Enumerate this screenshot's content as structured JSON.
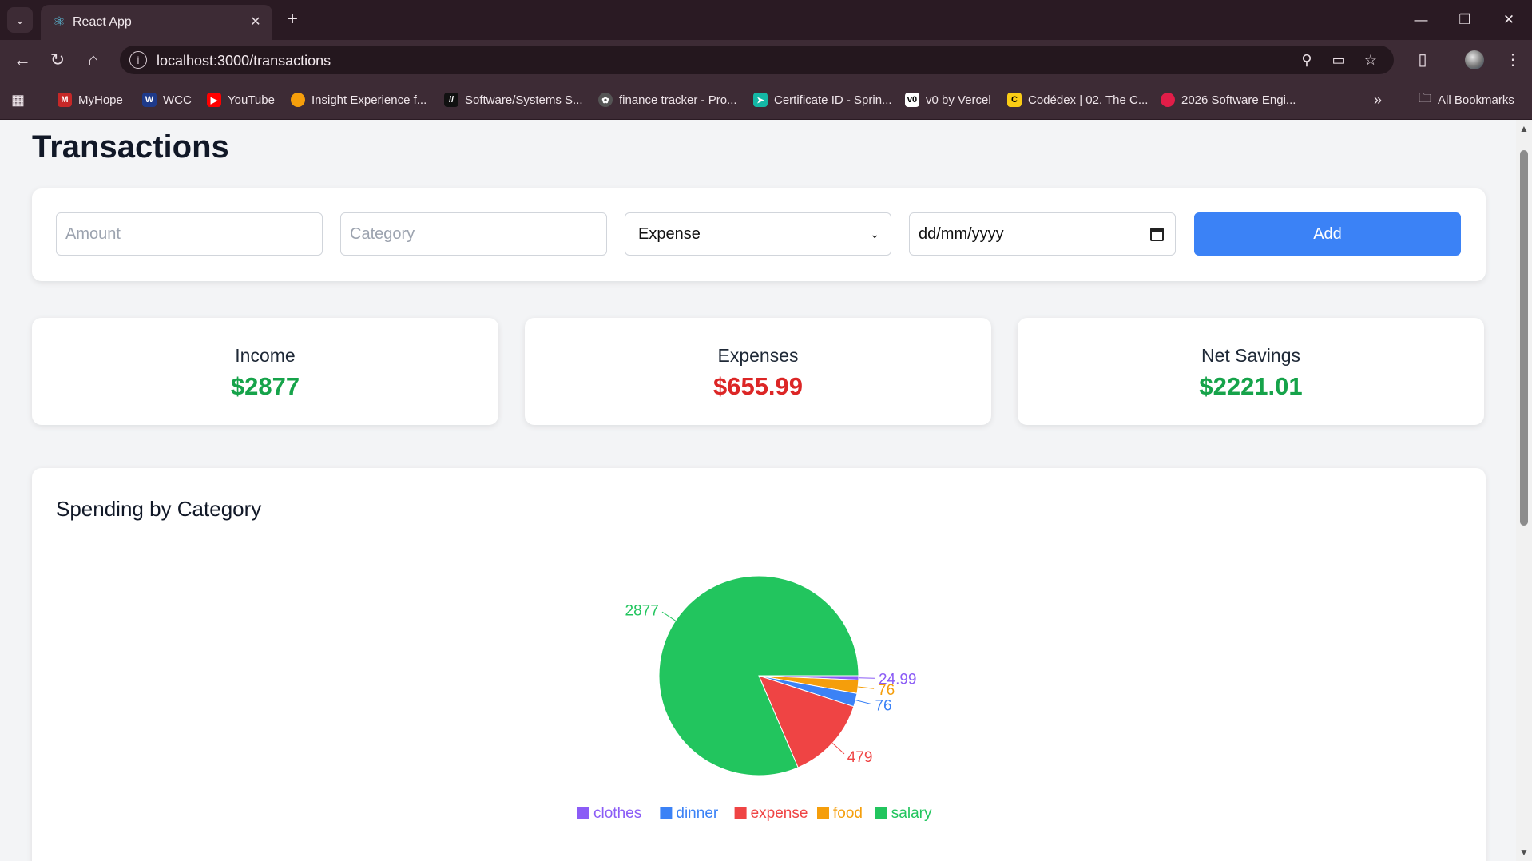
{
  "browser": {
    "tab_title": "React App",
    "url": "localhost:3000/transactions",
    "bookmarks": [
      {
        "label": "MyHope",
        "color": "#c62828"
      },
      {
        "label": "WCC",
        "color": "#1e3a8a"
      },
      {
        "label": "YouTube",
        "color": "#ff0000"
      },
      {
        "label": "Insight Experience f...",
        "color": "#f59e0b"
      },
      {
        "label": "Software/Systems S...",
        "color": "#111111"
      },
      {
        "label": "finance tracker - Pro...",
        "color": "#444444"
      },
      {
        "label": "Certificate ID - Sprin...",
        "color": "#14b8a6"
      },
      {
        "label": "v0 by Vercel",
        "color": "#ffffff"
      },
      {
        "label": "Codédex | 02. The C...",
        "color": "#facc15"
      },
      {
        "label": "2026 Software Engi...",
        "color": "#e11d48"
      }
    ],
    "all_bookmarks_label": "All Bookmarks"
  },
  "page": {
    "title": "Transactions"
  },
  "form": {
    "amount_placeholder": "Amount",
    "category_placeholder": "Category",
    "type_selected": "Expense",
    "date_placeholder": "dd/mm/yyyy",
    "add_label": "Add"
  },
  "stats": {
    "income_label": "Income",
    "income_value": "$2877",
    "expenses_label": "Expenses",
    "expenses_value": "$655.99",
    "savings_label": "Net Savings",
    "savings_value": "$2221.01"
  },
  "colors": {
    "positive": "#16a34a",
    "negative": "#dc2626",
    "accent": "#3b82f6"
  },
  "chart_title": "Spending by Category",
  "chart_data": {
    "type": "pie",
    "title": "Spending by Category",
    "slices": [
      {
        "label": "clothes",
        "value": 24.99,
        "value_label": "24.99",
        "color": "#8b5cf6"
      },
      {
        "label": "food",
        "value": 76,
        "value_label": "76",
        "color": "#f59e0b"
      },
      {
        "label": "dinner",
        "value": 76,
        "value_label": "76",
        "color": "#3b82f6"
      },
      {
        "label": "expense",
        "value": 479,
        "value_label": "479",
        "color": "#ef4444"
      },
      {
        "label": "salary",
        "value": 2877,
        "value_label": "2877",
        "color": "#22c55e"
      }
    ],
    "legend": [
      "clothes",
      "dinner",
      "expense",
      "food",
      "salary"
    ],
    "legend_position": "bottom"
  }
}
